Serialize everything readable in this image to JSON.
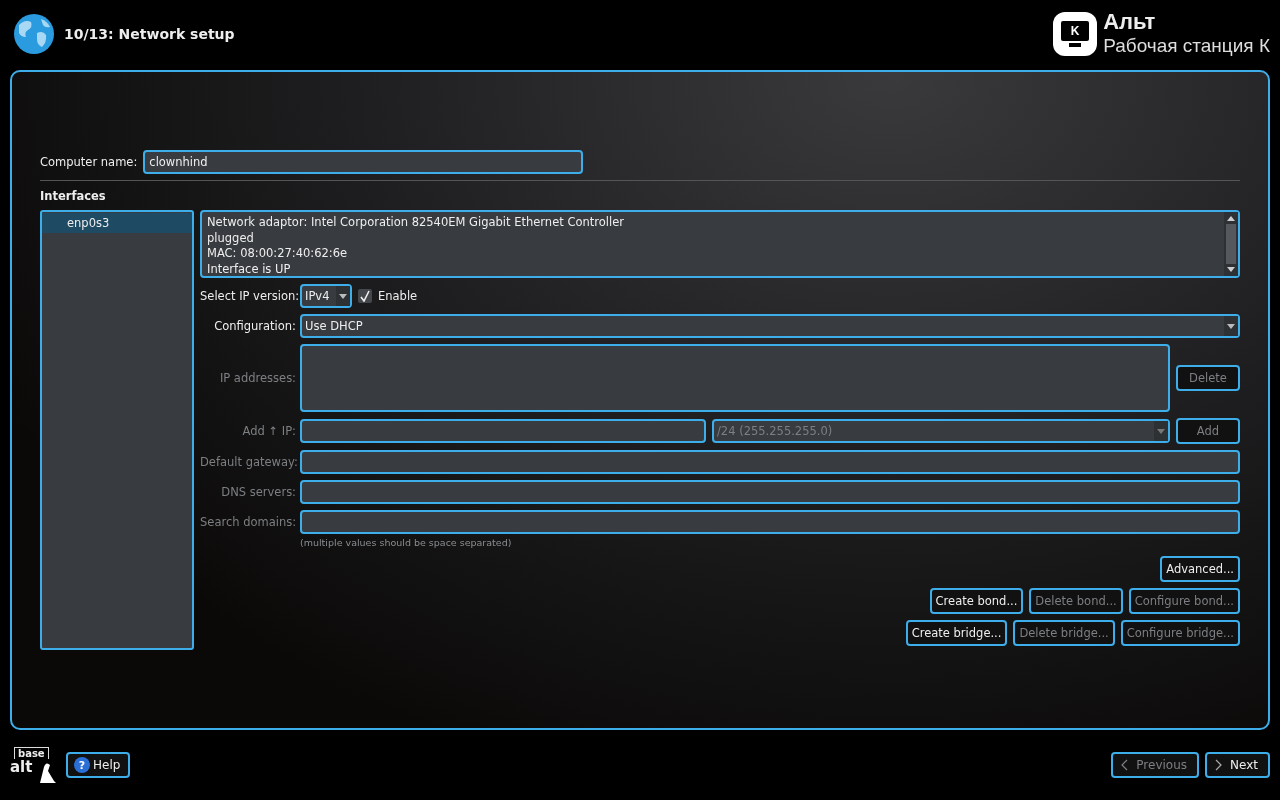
{
  "header": {
    "step_title": "10/13: Network setup",
    "brand_letter": "K",
    "brand_name": "Альт",
    "brand_product": "Рабочая станция К"
  },
  "computer_name": {
    "label": "Computer name:",
    "value": "clownhind"
  },
  "interfaces": {
    "heading": "Interfaces",
    "items": [
      {
        "name": "enp0s3",
        "selected": true
      }
    ]
  },
  "adapter_info": [
    "Network adaptor: Intel Corporation 82540EM Gigabit Ethernet Controller",
    "plugged",
    "MAC: 08:00:27:40:62:6e",
    "Interface is UP"
  ],
  "ip_version": {
    "label": "Select IP version:",
    "value": "IPv4",
    "enable_label": "Enable",
    "enabled": true
  },
  "configuration": {
    "label": "Configuration:",
    "value": "Use DHCP"
  },
  "ip_addresses": {
    "label": "IP addresses:",
    "disabled": true,
    "delete_button": "Delete"
  },
  "add_ip": {
    "label": "Add ↑ IP:",
    "netmask": "/24 (255.255.255.0)",
    "add_button": "Add",
    "disabled": true
  },
  "fields": [
    {
      "label": "Default gateway:",
      "disabled": true
    },
    {
      "label": "DNS servers:",
      "disabled": true
    },
    {
      "label": "Search domains:",
      "disabled": true
    }
  ],
  "hint": "(multiple values should be space separated)",
  "button_rows": [
    [
      {
        "label": "Advanced...",
        "disabled": false
      }
    ],
    [
      {
        "label": "Create bond...",
        "disabled": false
      },
      {
        "label": "Delete bond...",
        "disabled": true
      },
      {
        "label": "Configure bond...",
        "disabled": true
      }
    ],
    [
      {
        "label": "Create bridge...",
        "disabled": false
      },
      {
        "label": "Delete bridge...",
        "disabled": true
      },
      {
        "label": "Configure bridge...",
        "disabled": true
      }
    ]
  ],
  "footer": {
    "logo_top": "base",
    "logo_bottom": "alt",
    "help_icon": "?",
    "help": "Help",
    "previous": {
      "label": "Previous",
      "disabled": true
    },
    "next": {
      "label": "Next",
      "disabled": false
    }
  }
}
